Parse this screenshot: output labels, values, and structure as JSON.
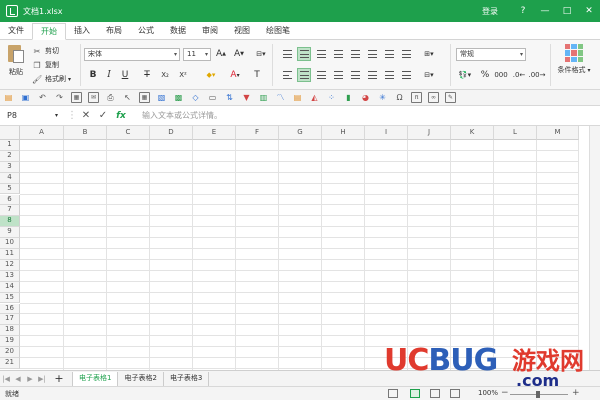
{
  "window": {
    "title": "文档1.xlsx",
    "login": "登录",
    "controls": [
      "?",
      "—",
      "□",
      "✕"
    ]
  },
  "menu": {
    "tabs": [
      "文件",
      "开始",
      "插入",
      "布局",
      "公式",
      "数据",
      "审阅",
      "视图",
      "绘图笔"
    ],
    "active_index": 1
  },
  "ribbon": {
    "paste_label": "粘贴",
    "cut_label": "剪切",
    "copy_label": "复制",
    "format_painter_label": "格式刷",
    "font_name": "宋体",
    "font_size": "11",
    "number_format": "常规",
    "conditional_format_label": "条件格式"
  },
  "formula_bar": {
    "cell_ref": "P8",
    "placeholder": "输入文本或公式详情。"
  },
  "grid": {
    "columns": [
      "A",
      "B",
      "C",
      "D",
      "E",
      "F",
      "G",
      "H",
      "I",
      "J",
      "K",
      "L",
      "M"
    ],
    "rows": [
      "1",
      "2",
      "3",
      "4",
      "5",
      "6",
      "7",
      "8",
      "9",
      "10",
      "11",
      "12",
      "13",
      "14",
      "15",
      "16",
      "17",
      "18",
      "19",
      "20",
      "21"
    ],
    "active_row": "8"
  },
  "sheets": {
    "tabs": [
      "电子表格1",
      "电子表格2",
      "电子表格3"
    ],
    "active_index": 0
  },
  "status": {
    "text": "就绪",
    "zoom": "100%"
  },
  "watermark": {
    "brand_uc": "UC",
    "brand_bug": "BUG",
    "cn": "游戏网",
    "domain": ".com"
  },
  "colors": {
    "accent": "#1ea04c",
    "active_header": "#bfe2c8"
  },
  "icons": {
    "cut": "scissors-icon",
    "copy": "copy-icon",
    "format_painter": "brush-icon",
    "paste": "clipboard-icon"
  }
}
